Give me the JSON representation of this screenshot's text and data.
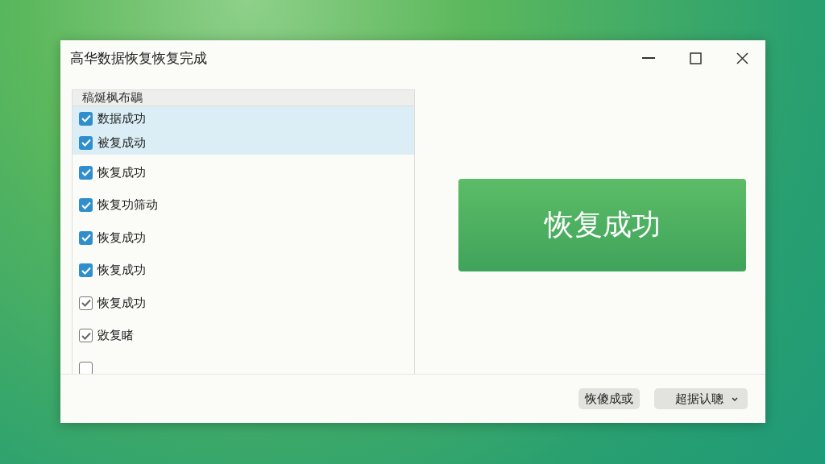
{
  "window": {
    "title": "高华数据恢复恢复完成"
  },
  "list": {
    "header": "稿烻枫布鶡",
    "items": [
      {
        "label": "数据成功",
        "checked": true,
        "kind": "accent",
        "selected": true
      },
      {
        "label": "被复成动",
        "checked": true,
        "kind": "accent",
        "selected": true
      },
      {
        "label": "恢复成功",
        "checked": true,
        "kind": "accent",
        "selected": false
      },
      {
        "label": "恢复功筛动",
        "checked": true,
        "kind": "accent",
        "selected": false
      },
      {
        "label": "恢复成功",
        "checked": true,
        "kind": "accent",
        "selected": false
      },
      {
        "label": "恢复成功",
        "checked": true,
        "kind": "accent",
        "selected": false
      },
      {
        "label": "恢复成功",
        "checked": true,
        "kind": "outline",
        "selected": false
      },
      {
        "label": "敓复睹",
        "checked": true,
        "kind": "outline",
        "selected": false
      },
      {
        "checked": false,
        "kind": "outline",
        "selected": false
      }
    ]
  },
  "status_button": {
    "label": "恢复成功"
  },
  "footer": {
    "buttons": [
      {
        "label": "恢傻成或",
        "kind": "plain"
      },
      {
        "label": "超据认聰",
        "kind": "dropdown"
      }
    ]
  }
}
